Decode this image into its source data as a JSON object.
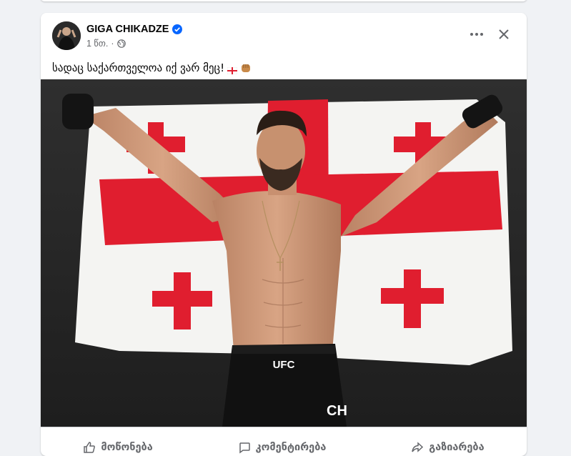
{
  "post": {
    "author": "GIGA CHIKADZE",
    "time": "1 წთ.",
    "separator": "·",
    "caption": "სადაც საქართველოა იქ ვარ მეც!"
  },
  "photo": {
    "shorts_label": "UFC",
    "shorts_side_text": "CH"
  },
  "actions": {
    "like": "მოწონება",
    "comment": "კომენტირება",
    "share": "გაზიარება"
  },
  "icons": {
    "verified": "verified-badge-icon",
    "audience": "globe-icon",
    "more": "more-options-icon",
    "close": "close-icon"
  },
  "colors": {
    "accent": "#0866ff",
    "flag_red": "#e01e2f",
    "text_secondary": "#65676b"
  }
}
